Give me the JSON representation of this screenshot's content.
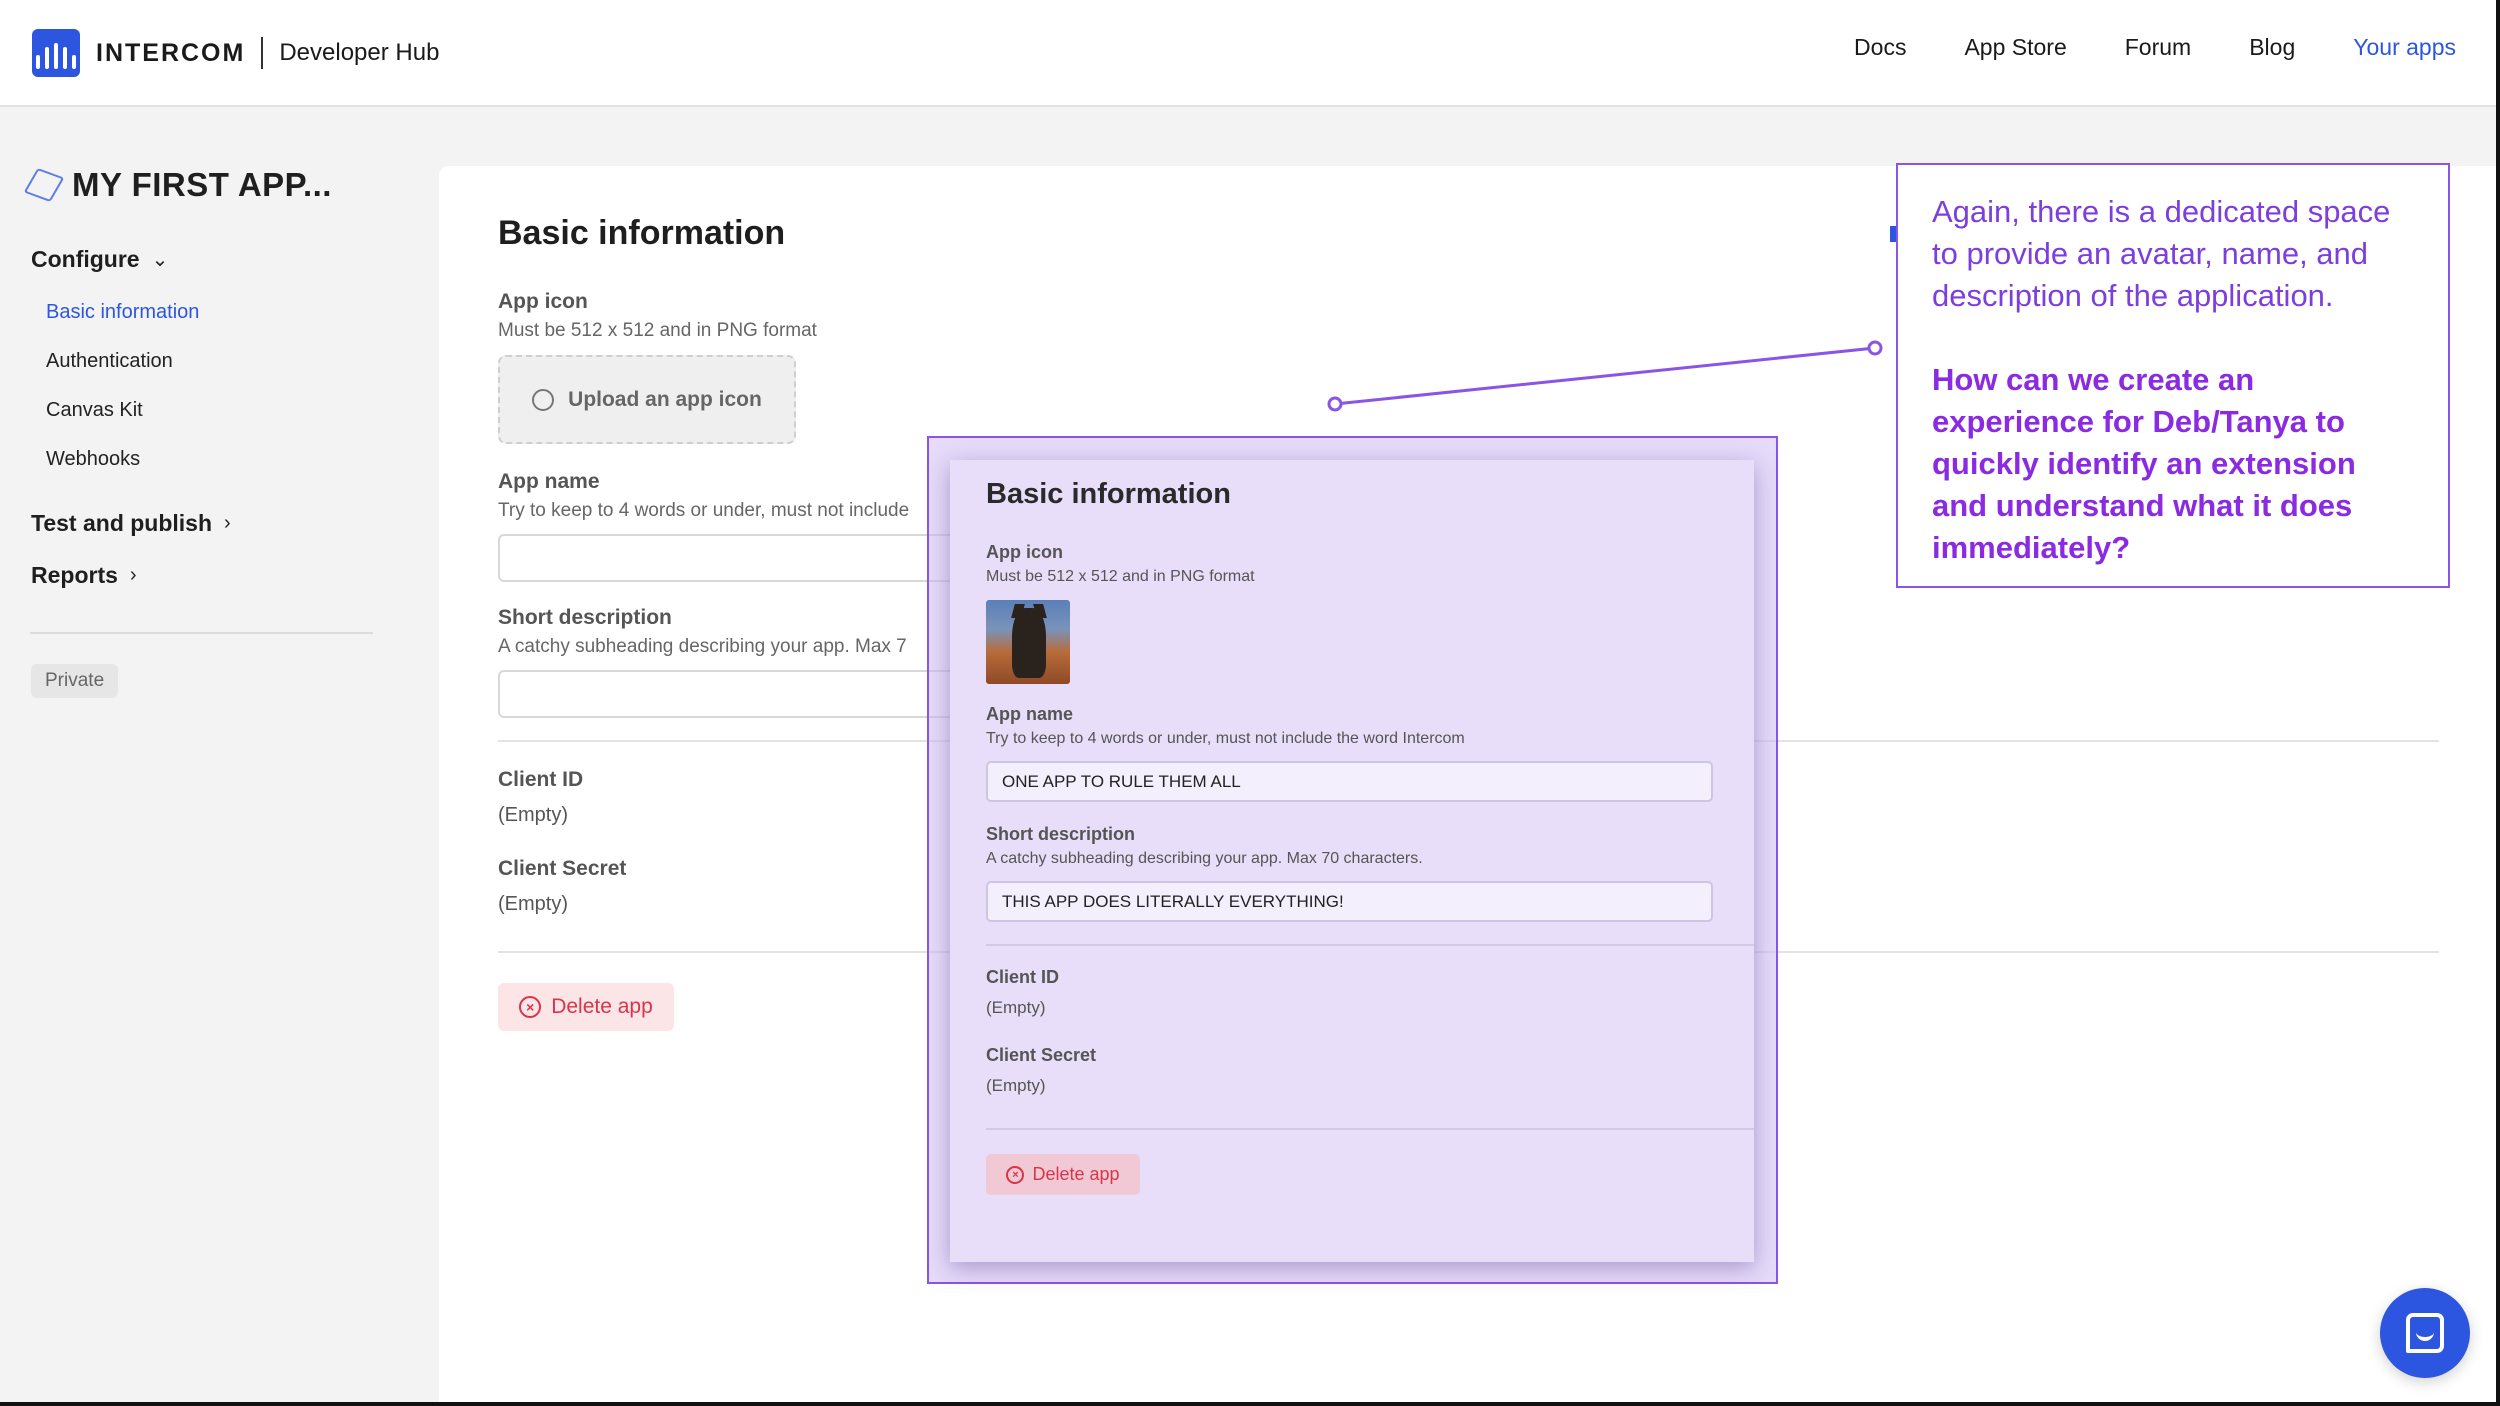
{
  "header": {
    "brand": "INTERCOM",
    "subtitle": "Developer Hub",
    "nav": [
      "Docs",
      "App Store",
      "Forum",
      "Blog",
      "Your apps"
    ]
  },
  "sidebar": {
    "app_title": "MY FIRST APP...",
    "configure": "Configure",
    "items": [
      "Basic information",
      "Authentication",
      "Canvas Kit",
      "Webhooks"
    ],
    "test_publish": "Test and publish",
    "reports": "Reports",
    "badge": "Private"
  },
  "main": {
    "title": "Basic information",
    "app_icon_label": "App icon",
    "app_icon_hint": "Must be 512 x 512 and in PNG format",
    "upload_label": "Upload an app icon",
    "app_name_label": "App name",
    "app_name_hint": "Try to keep to 4 words or under, must not include",
    "short_desc_label": "Short description",
    "short_desc_hint": "A catchy subheading describing your app. Max 7",
    "client_id_label": "Client ID",
    "client_id_value": "(Empty)",
    "client_secret_label": "Client Secret",
    "client_secret_value": "(Empty)",
    "delete_label": "Delete app"
  },
  "overlay": {
    "title": "Basic information",
    "app_icon_label": "App icon",
    "app_icon_hint": "Must be 512 x 512 and in PNG format",
    "app_name_label": "App name",
    "app_name_hint": "Try to keep to 4 words or under, must not include the word Intercom",
    "app_name_value": "ONE APP TO RULE THEM ALL",
    "short_desc_label": "Short description",
    "short_desc_hint": "A catchy subheading describing your app. Max 70 characters.",
    "short_desc_value": "THIS APP DOES LITERALLY EVERYTHING!",
    "client_id_label": "Client ID",
    "client_id_value": "(Empty)",
    "client_secret_label": "Client Secret",
    "client_secret_value": "(Empty)",
    "delete_label": "Delete app"
  },
  "annotation": {
    "text": "Again, there is a dedicated space to provide an avatar, name, and description of the application.",
    "question": "How can we create an experience for Deb/Tanya to quickly identify an extension and understand what it does immediately?"
  },
  "colors": {
    "brand_blue": "#2c56e0",
    "annotation_purple": "#8a55e6",
    "danger": "#d9354a"
  },
  "icons": [
    "intercom-logo-icon",
    "cube-icon",
    "chevron-down-icon",
    "chevron-right-icon",
    "upload-cloud-icon",
    "close-circle-icon",
    "chat-icon"
  ]
}
